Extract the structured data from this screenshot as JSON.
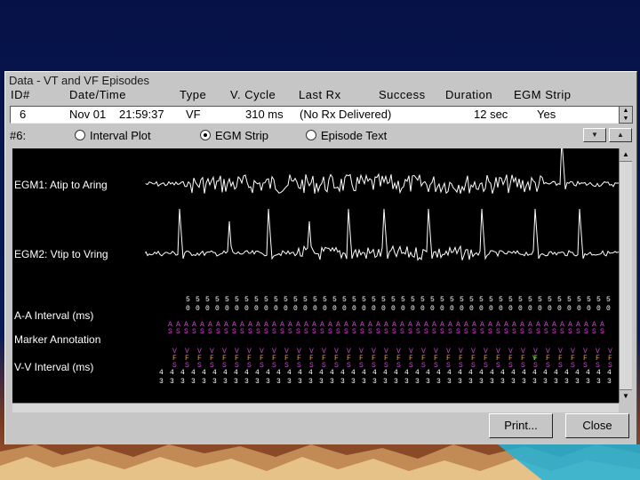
{
  "window": {
    "title": "Data - VT and VF Episodes"
  },
  "columns": [
    "ID#",
    "Date/Time",
    "Type",
    "V. Cycle",
    "Last Rx",
    "Success",
    "Duration",
    "EGM Strip"
  ],
  "row": {
    "id": "6",
    "date": "Nov 01",
    "time": "21:59:37",
    "type": "VF",
    "vcycle": "310 ms",
    "lastrx": "(No Rx Delivered)",
    "duration": "12 sec",
    "egm": "Yes"
  },
  "episode_label": "#6:",
  "view_options": [
    {
      "label": "Interval Plot",
      "selected": false
    },
    {
      "label": "EGM Strip",
      "selected": true
    },
    {
      "label": "Episode Text",
      "selected": false
    }
  ],
  "strip": {
    "egm1": "EGM1: Atip to Aring",
    "egm2": "EGM2: Vtip to Vring",
    "aa": "A-A Interval (ms)",
    "marker": "Marker Annotation",
    "vv": "V-V Interval (ms)"
  },
  "buttons": {
    "print": "Print...",
    "close": "Close"
  },
  "colors": {
    "background": "#061247",
    "marker_magenta": "#d040d0",
    "marker_orange": "#f0a020",
    "marker_green": "#30d030"
  }
}
